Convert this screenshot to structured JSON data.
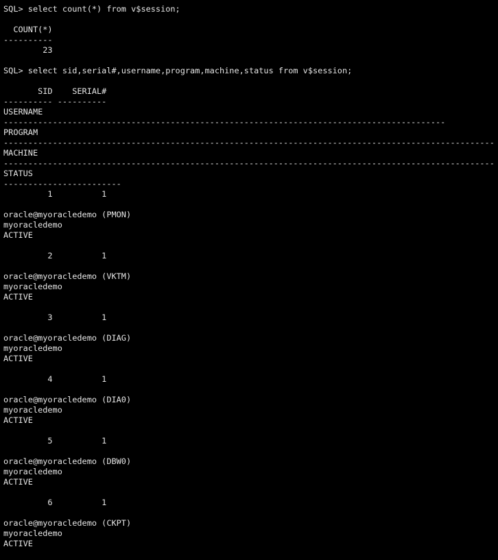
{
  "terminal": {
    "lines": [
      "SQL> select count(*) from v$session;",
      "",
      "  COUNT(*)",
      "----------",
      "        23",
      "",
      "SQL> select sid,serial#,username,program,machine,status from v$session;",
      "",
      "       SID    SERIAL#",
      "---------- ----------",
      "USERNAME",
      "------------------------------------------------------------------------------------------",
      "PROGRAM",
      "----------------------------------------------------------------------------------------------------",
      "MACHINE",
      "----------------------------------------------------------------------------------------------------",
      "STATUS",
      "------------------------",
      "         1          1",
      "",
      "oracle@myoracledemo (PMON)",
      "myoracledemo",
      "ACTIVE",
      "",
      "         2          1",
      "",
      "oracle@myoracledemo (VKTM)",
      "myoracledemo",
      "ACTIVE",
      "",
      "         3          1",
      "",
      "oracle@myoracledemo (DIAG)",
      "myoracledemo",
      "ACTIVE",
      "",
      "         4          1",
      "",
      "oracle@myoracledemo (DIA0)",
      "myoracledemo",
      "ACTIVE",
      "",
      "         5          1",
      "",
      "oracle@myoracledemo (DBW0)",
      "myoracledemo",
      "ACTIVE",
      "",
      "         6          1",
      "",
      "oracle@myoracledemo (CKPT)",
      "myoracledemo",
      "ACTIVE"
    ]
  }
}
